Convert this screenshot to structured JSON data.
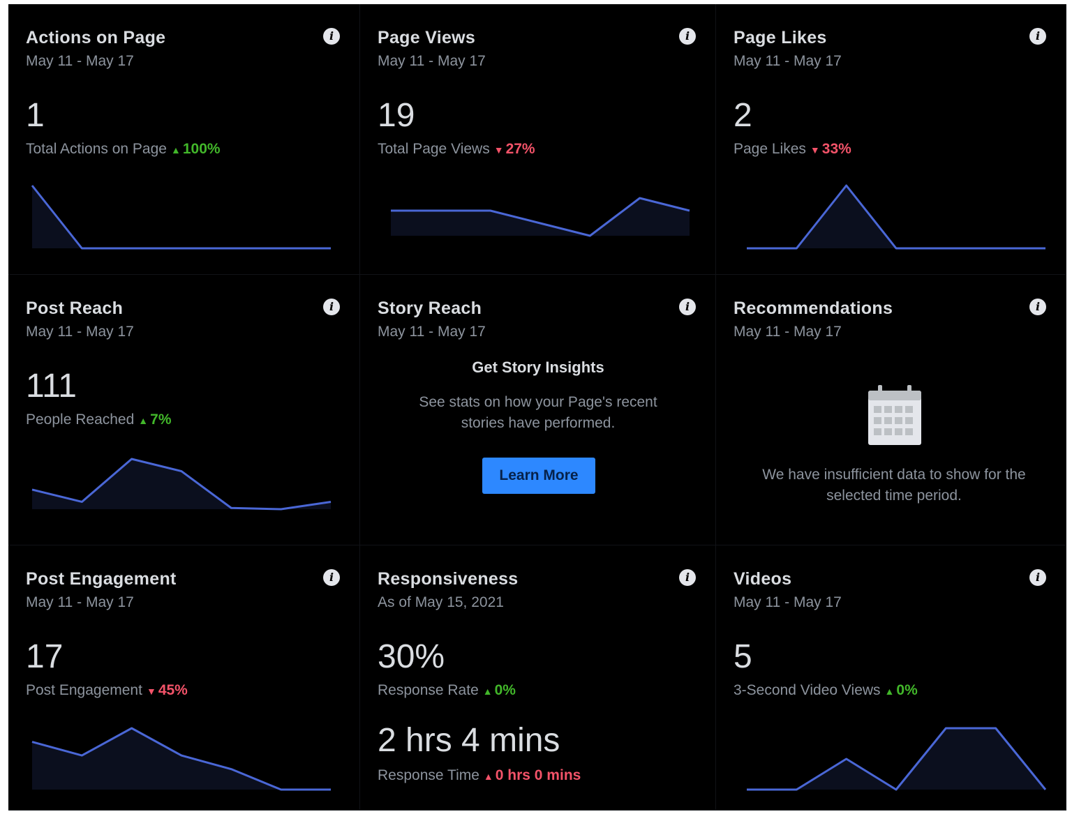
{
  "colors": {
    "background": "#000000",
    "line": "#4a67d6",
    "fill": "#0b0f1e",
    "up": "#42b72a",
    "down": "#f35369",
    "button": "#2d88ff"
  },
  "cards": [
    {
      "id": "actions",
      "title": "Actions on Page",
      "date": "May 11 - May 17",
      "value": "1",
      "metric": "Total Actions on Page",
      "change": "100%",
      "direction": "up",
      "chart_data": {
        "type": "area",
        "values": [
          5,
          0,
          0,
          0,
          0,
          0,
          0
        ]
      }
    },
    {
      "id": "views",
      "title": "Page Views",
      "date": "May 11 - May 17",
      "value": "19",
      "metric": "Total Page Views",
      "change": "27%",
      "direction": "down",
      "chart_data": {
        "type": "area",
        "values": [
          3,
          3,
          3,
          2,
          1,
          4,
          3
        ]
      }
    },
    {
      "id": "likes",
      "title": "Page Likes",
      "date": "May 11 - May 17",
      "value": "2",
      "metric": "Page Likes",
      "change": "33%",
      "direction": "down",
      "chart_data": {
        "type": "area",
        "values": [
          0,
          0,
          1,
          0,
          0,
          0,
          0
        ]
      }
    },
    {
      "id": "reach",
      "title": "Post Reach",
      "date": "May 11 - May 17",
      "value": "111",
      "metric": "People Reached",
      "change": "7%",
      "direction": "up",
      "chart_data": {
        "type": "area",
        "values": [
          20,
          10,
          45,
          35,
          5,
          4,
          10
        ]
      }
    },
    {
      "id": "story",
      "title": "Story Reach",
      "date": "May 11 - May 17",
      "cta_title": "Get Story Insights",
      "cta_text": "See stats on how your Page's recent stories have performed.",
      "button": "Learn More"
    },
    {
      "id": "recs",
      "title": "Recommendations",
      "date": "May 11 - May 17",
      "empty_text": "We have insufficient data to show for the selected time period.",
      "icon": "calendar-icon"
    },
    {
      "id": "engagement",
      "title": "Post Engagement",
      "date": "May 11 - May 17",
      "value": "17",
      "metric": "Post Engagement",
      "change": "45%",
      "direction": "down",
      "chart_data": {
        "type": "area",
        "values": [
          7,
          5,
          9,
          5,
          3,
          0,
          0
        ]
      }
    },
    {
      "id": "response",
      "title": "Responsiveness",
      "date": "As of May 15, 2021",
      "value": "30%",
      "metric": "Response Rate",
      "change": "0%",
      "direction": "up",
      "value2": "2 hrs 4 mins",
      "metric2": "Response Time",
      "change2": "0 hrs 0 mins",
      "direction2": "uprt"
    },
    {
      "id": "videos",
      "title": "Videos",
      "date": "May 11 - May 17",
      "value": "5",
      "metric": "3-Second Video Views",
      "change": "0%",
      "direction": "up",
      "chart_data": {
        "type": "area",
        "values": [
          0,
          0,
          1,
          0,
          2,
          2,
          0
        ]
      }
    }
  ]
}
